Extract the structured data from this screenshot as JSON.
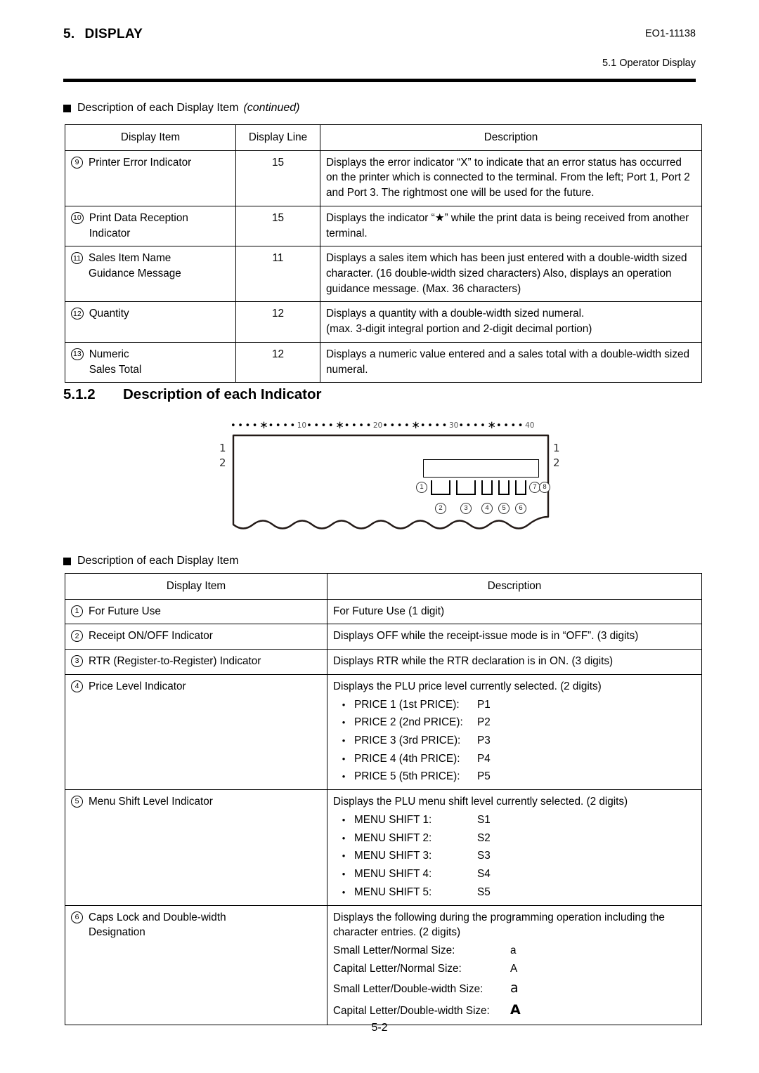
{
  "header": {
    "chapter_num": "5.",
    "chapter_title": "DISPLAY",
    "doc_code": "EO1-11138",
    "subsection": "5.1  Operator Display"
  },
  "section_continued": {
    "title": "Description of each Display Item",
    "title_italic": "(continued)"
  },
  "table_continued": {
    "columns": [
      "Display Item",
      "Display Line",
      "Description"
    ],
    "rows": [
      {
        "index": "9",
        "item": "Printer Error Indicator",
        "item_line2": "",
        "line": "15",
        "description": "Displays the error indicator “X” to indicate that an error status has occurred on the printer which is connected to the terminal. From the left; Port 1, Port 2 and Port 3. The rightmost one will be used for the future."
      },
      {
        "index": "10",
        "item": "Print Data Reception",
        "item_line2": "Indicator",
        "line": "15",
        "description": "Displays the indicator “★” while the print data is being received from another terminal."
      },
      {
        "index": "11",
        "item": "Sales Item Name",
        "item_line2": "Guidance Message",
        "line": "11",
        "description": "Displays a sales item which has been just entered with a double-width sized character. (16 double-width sized characters) Also, displays an operation guidance message. (Max. 36 characters)"
      },
      {
        "index": "12",
        "item": "Quantity",
        "item_line2": "",
        "line": "12",
        "description": "Displays a quantity with a double-width sized numeral.\n(max. 3-digit integral portion and 2-digit decimal portion)"
      },
      {
        "index": "13",
        "item": "Numeric",
        "item_line2": "Sales Total",
        "line": "12",
        "description": "Displays a numeric value entered and a sales total with a double-width sized numeral."
      }
    ]
  },
  "section_512": {
    "number": "5.1.2",
    "title": "Description of each Indicator"
  },
  "diagram": {
    "ruler_marks": [
      "10",
      "20",
      "30",
      "40"
    ],
    "line_label_left_1": "1",
    "line_label_left_2": "2",
    "line_label_right_1": "1",
    "line_label_right_2": "2",
    "callouts": [
      "1",
      "2",
      "3",
      "4",
      "5",
      "6",
      "7",
      "8"
    ]
  },
  "section_items": {
    "title": "Description of each Display Item"
  },
  "table_items": {
    "columns": [
      "Display Item",
      "Description"
    ],
    "rows": [
      {
        "index": "1",
        "item": "For Future Use",
        "item_line2": "",
        "description": "For Future Use (1 digit)",
        "sublist": []
      },
      {
        "index": "2",
        "item": "Receipt ON/OFF Indicator",
        "item_line2": "",
        "description": "Displays OFF while the receipt-issue mode is in “OFF”. (3 digits)",
        "sublist": []
      },
      {
        "index": "3",
        "item": "RTR (Register-to-Register) Indicator",
        "item_line2": "",
        "description": "Displays RTR while the RTR declaration is in ON. (3 digits)",
        "sublist": []
      },
      {
        "index": "4",
        "item": "Price Level Indicator",
        "item_line2": "",
        "description": "Displays the PLU price level currently selected. (2 digits)",
        "sublist": [
          {
            "label": "PRICE 1 (1st PRICE):",
            "value": "P1"
          },
          {
            "label": "PRICE 2 (2nd PRICE):",
            "value": "P2"
          },
          {
            "label": "PRICE 3 (3rd PRICE):",
            "value": "P3"
          },
          {
            "label": "PRICE 4 (4th PRICE):",
            "value": "P4"
          },
          {
            "label": "PRICE 5 (5th PRICE):",
            "value": "P5"
          }
        ]
      },
      {
        "index": "5",
        "item": "Menu Shift Level Indicator",
        "item_line2": "",
        "description": "Displays the PLU menu shift level currently selected. (2 digits)",
        "sublist": [
          {
            "label": "MENU SHIFT 1:",
            "value": "S1"
          },
          {
            "label": "MENU SHIFT 2:",
            "value": "S2"
          },
          {
            "label": "MENU SHIFT 3:",
            "value": "S3"
          },
          {
            "label": "MENU SHIFT 4:",
            "value": "S4"
          },
          {
            "label": "MENU SHIFT 5:",
            "value": "S5"
          }
        ]
      },
      {
        "index": "6",
        "item": "Caps Lock and Double-width",
        "item_line2": "Designation",
        "description": "Displays the following during the programming operation including the character entries. (2 digits)",
        "kvlist": [
          {
            "label": "Small Letter/Normal Size:",
            "value": "a",
            "style": "normal"
          },
          {
            "label": "Capital Letter/Normal Size:",
            "value": "A",
            "style": "normal"
          },
          {
            "label": "Small Letter/Double-width Size:",
            "value": "a",
            "style": "dw-small"
          },
          {
            "label": "Capital Letter/Double-width Size:",
            "value": "A",
            "style": "dw-caps"
          }
        ]
      }
    ]
  },
  "footer": {
    "page": "5-2"
  }
}
